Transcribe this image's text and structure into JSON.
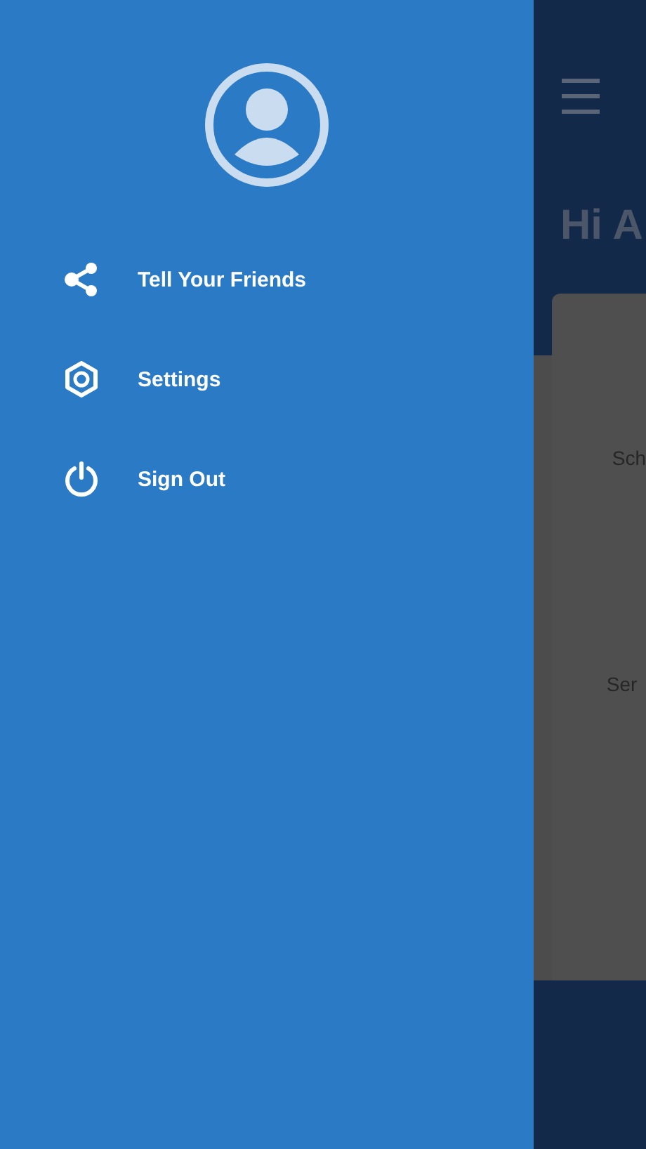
{
  "drawer": {
    "menu": [
      {
        "kind": "share",
        "label": "Tell Your Friends"
      },
      {
        "kind": "settings",
        "label": "Settings"
      },
      {
        "kind": "power",
        "label": "Sign Out"
      }
    ]
  },
  "background": {
    "greeting": "Hi A",
    "card_items": [
      "Sch",
      "Ser"
    ]
  }
}
